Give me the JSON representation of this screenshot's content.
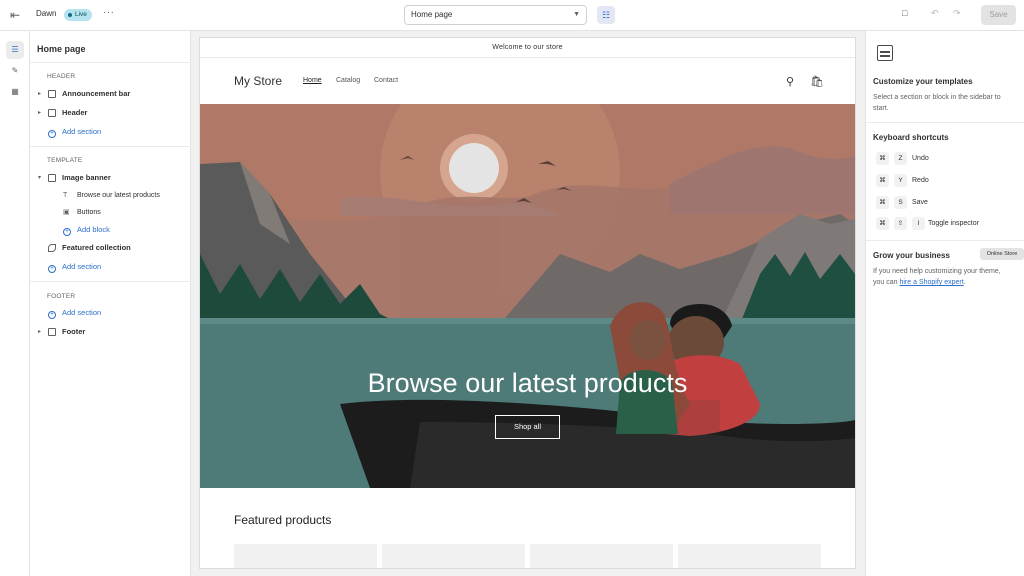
{
  "topbar": {
    "theme_name": "Dawn",
    "status": "Live",
    "more": "···",
    "page_select": "Home page",
    "save_label": "Save"
  },
  "sidebar": {
    "title": "Home page",
    "header_group": "HEADER",
    "header_items": [
      "Announcement bar",
      "Header"
    ],
    "add_section": "Add section",
    "template_group": "TEMPLATE",
    "image_banner": "Image banner",
    "banner_blocks": [
      "Browse our latest products",
      "Buttons"
    ],
    "add_block": "Add block",
    "featured_collection": "Featured collection",
    "footer_group": "FOOTER",
    "footer_item": "Footer"
  },
  "preview": {
    "announcement": "Welcome to our store",
    "store_name": "My Store",
    "nav": [
      "Home",
      "Catalog",
      "Contact"
    ],
    "hero_title": "Browse our latest products",
    "hero_button": "Shop all",
    "featured_title": "Featured products"
  },
  "right_panel": {
    "customize_title": "Customize your templates",
    "customize_text": "Select a section or block in the sidebar to start.",
    "shortcuts_title": "Keyboard shortcuts",
    "shortcuts": [
      {
        "keys": [
          "⌘",
          "Z"
        ],
        "label": "Undo"
      },
      {
        "keys": [
          "⌘",
          "Y"
        ],
        "label": "Redo"
      },
      {
        "keys": [
          "⌘",
          "S"
        ],
        "label": "Save"
      },
      {
        "keys": [
          "⌘",
          "⇧",
          "I"
        ],
        "label": "Toggle inspector"
      }
    ],
    "grow_title": "Grow your business",
    "grow_text": "If you need help customizing your theme, you can",
    "grow_link": "hire a Shopify expert",
    "grow_end": ".",
    "tooltip": "Online Store"
  },
  "colors": {
    "accent": "#2c6ecb",
    "live_badge": "#b5e3ee",
    "hero_sky": "#b27a66",
    "hero_water": "#4e7a78"
  }
}
